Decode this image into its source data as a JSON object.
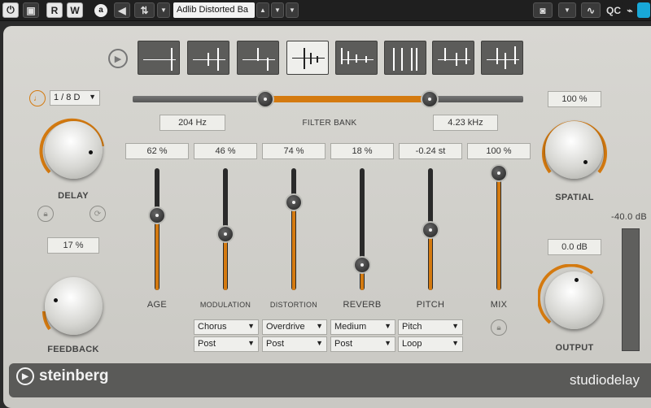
{
  "host": {
    "power_icon": "power-icon",
    "record_label": "R",
    "write_label": "W",
    "preset_name": "Adlib Distorted Ba",
    "qc_label": "QC"
  },
  "patterns": [
    "pattern-1",
    "pattern-2",
    "pattern-3",
    "pattern-4",
    "pattern-5",
    "pattern-6",
    "pattern-7",
    "pattern-8"
  ],
  "filter_bank": {
    "label": "FILTER BANK",
    "low": "204 Hz",
    "high": "4.23 kHz",
    "low_pos": 0.34,
    "high_pos": 0.76
  },
  "delay": {
    "sync_value": "1 / 8 D",
    "label": "DELAY",
    "accent": "#d47a10"
  },
  "feedback": {
    "value": "17 %",
    "label": "FEEDBACK"
  },
  "spatial": {
    "value": "100 %",
    "label": "SPATIAL"
  },
  "output": {
    "value": "0.0 dB",
    "label": "OUTPUT",
    "meter_label": "-40.0 dB"
  },
  "faders": [
    {
      "name": "age",
      "label": "AGE",
      "value": "62 %",
      "level": 0.62
    },
    {
      "name": "modulation",
      "label": "MODULATION",
      "value": "46 %",
      "level": 0.46
    },
    {
      "name": "distortion",
      "label": "DISTORTION",
      "value": "74 %",
      "level": 0.74
    },
    {
      "name": "reverb",
      "label": "REVERB",
      "value": "18 %",
      "level": 0.18
    },
    {
      "name": "pitch",
      "label": "PITCH",
      "value": "-0.24 st",
      "level": 0.49
    },
    {
      "name": "mix",
      "label": "MIX",
      "value": "100 %",
      "level": 1.0
    }
  ],
  "fx_selectors": [
    {
      "type": "Chorus",
      "position": "Post"
    },
    {
      "type": "Overdrive",
      "position": "Post"
    },
    {
      "type": "Medium",
      "position": "Post"
    },
    {
      "type": "Pitch",
      "position": "Loop"
    }
  ],
  "footer": {
    "brand": "steinberg",
    "product": "studiodelay"
  }
}
